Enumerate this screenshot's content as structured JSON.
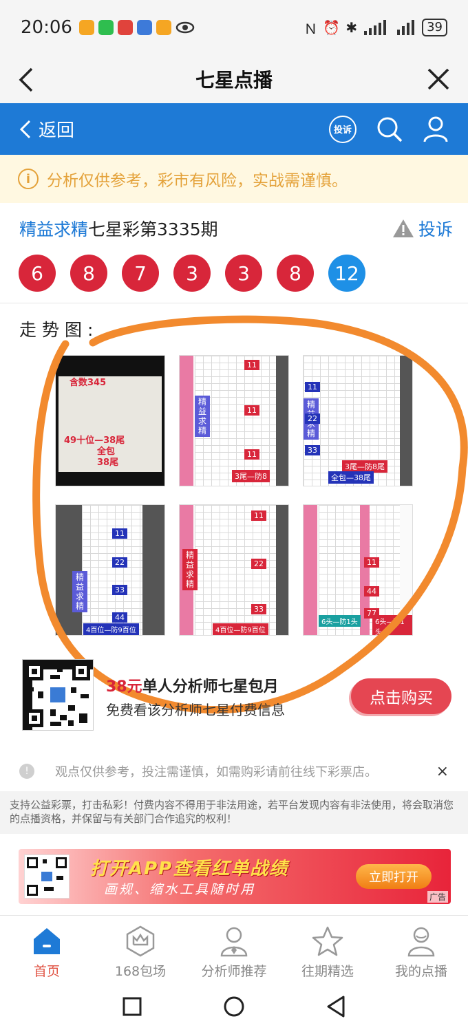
{
  "status_bar": {
    "time": "20:06",
    "battery": "39",
    "app_colors": [
      "#f5a623",
      "#2fbe4f",
      "#e0433c",
      "#3d7ad9",
      "#f5a623"
    ]
  },
  "title_bar": {
    "title": "七星点播"
  },
  "blue_bar": {
    "back_label": "返回",
    "complain_label": "投诉"
  },
  "notice": {
    "text": "分析仅供参考，彩市有风险，实战需谨慎。"
  },
  "issue": {
    "prefix": "精益求精",
    "title": "七星彩第3335期",
    "report_label": "投诉"
  },
  "balls": [
    {
      "value": "6",
      "color": "red"
    },
    {
      "value": "8",
      "color": "red"
    },
    {
      "value": "7",
      "color": "red"
    },
    {
      "value": "3",
      "color": "red"
    },
    {
      "value": "3",
      "color": "red"
    },
    {
      "value": "8",
      "color": "red"
    },
    {
      "value": "12",
      "color": "blue"
    }
  ],
  "trend": {
    "label": "走势图:",
    "thumbnails": [
      {
        "kind": "photo",
        "lines": [
          "含数345",
          "49十位—38尾",
          "全包",
          "38尾"
        ]
      },
      {
        "kind": "chart",
        "vlabel": "精益求精",
        "tags": [
          "11",
          "11",
          "11"
        ],
        "footer": "3尾—防8"
      },
      {
        "kind": "chart",
        "vlabel": "精益求精",
        "tags": [
          "11",
          "22",
          "33"
        ],
        "footer": "3尾—防8尾",
        "footer2": "全包—38尾"
      },
      {
        "kind": "chart",
        "vlabel": "精益求精",
        "tags": [
          "11",
          "22",
          "33",
          "44"
        ],
        "footer": "4百位—防9百位"
      },
      {
        "kind": "chart",
        "vlabel": "精益求精",
        "tags": [
          "11",
          "22",
          "33"
        ],
        "footer": "4百位—防9百位"
      },
      {
        "kind": "chart",
        "vlabel": "",
        "tags": [
          "11",
          "44",
          "77"
        ],
        "footer": "6头—防1头"
      }
    ]
  },
  "promo": {
    "price": "38元",
    "title": "单人分析师七星包月",
    "desc": "免费看该分析师七星付费信息",
    "buy_label": "点击购买"
  },
  "disclaimer": {
    "text": "观点仅供参考，投注需谨慎，如需购彩请前往线下彩票店。",
    "close": "×"
  },
  "legal": {
    "text": "支持公益彩票，打击私彩！付费内容不得用于非法用途，若平台发现内容有非法使用，将会取消您的点播资格，并保留与有关部门合作追究的权利！"
  },
  "ad": {
    "title": "打开APP查看红单战绩",
    "subtitle": "画规、缩水工具随时用",
    "button": "立即打开",
    "tag": "广告"
  },
  "tabbar": [
    {
      "label": "首页",
      "active": true
    },
    {
      "label": "168包场",
      "active": false
    },
    {
      "label": "分析师推荐",
      "active": false
    },
    {
      "label": "往期精选",
      "active": false
    },
    {
      "label": "我的点播",
      "active": false
    }
  ],
  "colors": {
    "brand_blue": "#1e7ad6",
    "ball_red": "#d8263a",
    "ball_blue": "#1e90e6",
    "annotation_orange": "#f28a2e",
    "notice_text": "#e4a23a"
  }
}
